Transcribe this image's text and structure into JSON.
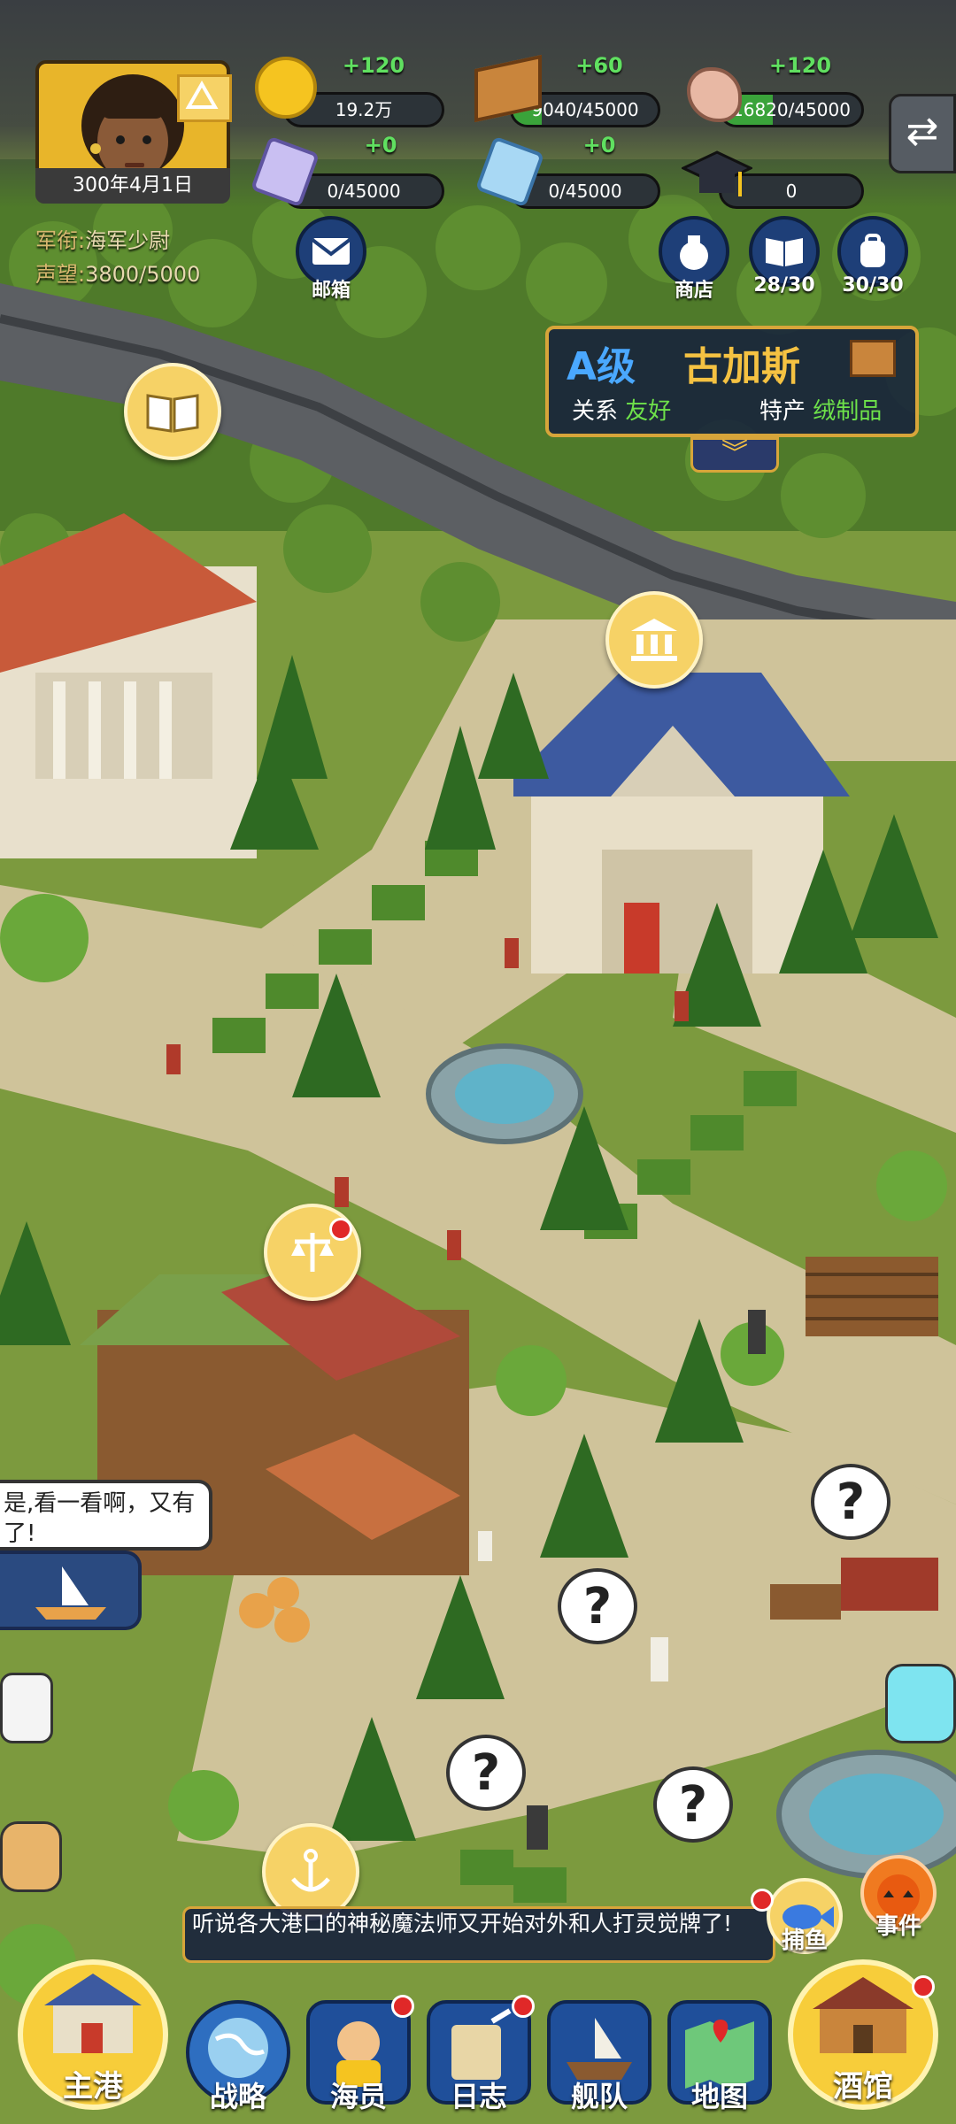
{
  "player": {
    "date": "300年4月1日",
    "rank_label": "军衔:",
    "rank_value": "海军少尉",
    "fame_label": "声望:",
    "fame_value": "3800/5000"
  },
  "resources": [
    {
      "name": "gold",
      "icon": "gold-coin-icon",
      "increment": "+120",
      "value": "19.2万",
      "fill": 0
    },
    {
      "name": "wood",
      "icon": "wood-icon",
      "increment": "+60",
      "value": "9040/45000",
      "fill": 0.2
    },
    {
      "name": "stone",
      "icon": "stone-icon",
      "increment": "+120",
      "value": "16820/45000",
      "fill": 0.37
    },
    {
      "name": "purple-crystal",
      "icon": "purple-crystal-icon",
      "increment": "+0",
      "value": "0/45000",
      "fill": 0
    },
    {
      "name": "blue-crystal",
      "icon": "blue-crystal-icon",
      "increment": "+0",
      "value": "0/45000",
      "fill": 0
    },
    {
      "name": "scholar",
      "icon": "graduation-cap-icon",
      "increment": "",
      "value": "0",
      "fill": 0
    }
  ],
  "top_buttons": {
    "mail": "邮箱",
    "shop": "商店",
    "book_count": "28/30",
    "bag_count": "30/30"
  },
  "location": {
    "grade": "A级",
    "name": "古加斯",
    "relation_label": "关系",
    "relation_value": "友好",
    "product_label": "特产",
    "product_value": "绒制品"
  },
  "chat": {
    "line1": "是,看一看啊，又有",
    "line2": "了!"
  },
  "news": {
    "text": "听说各大港口的神秘魔法师又开始对外和人打灵觉牌了!"
  },
  "side_buttons": {
    "fishing": "捕鱼",
    "event": "事件"
  },
  "nav": {
    "home": "主港",
    "strategy": "战略",
    "crew": "海员",
    "log": "日志",
    "fleet": "舰队",
    "map": "地图",
    "tavern": "酒馆"
  },
  "colors": {
    "accent_gold": "#f6d266",
    "panel_blue": "#1f4f9a",
    "increment_green": "#60e060",
    "alert_red": "#e02828"
  }
}
